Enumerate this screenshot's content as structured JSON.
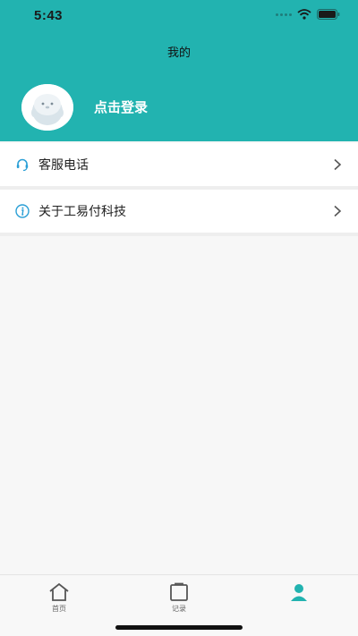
{
  "status": {
    "time": "5:43"
  },
  "header": {
    "title": "我的",
    "login_label": "点击登录"
  },
  "menu": [
    {
      "label": "客服电话",
      "icon": "headset-icon"
    },
    {
      "label": "关于工易付科技",
      "icon": "info-icon"
    }
  ],
  "tabbar": {
    "tabs": [
      {
        "label": "首页",
        "icon": "home-icon"
      },
      {
        "label": "记录",
        "icon": "clipboard-icon"
      },
      {
        "label": "",
        "icon": "user-icon"
      }
    ]
  },
  "colors": {
    "accent": "#22b3b0",
    "background": "#f7f7f7"
  }
}
